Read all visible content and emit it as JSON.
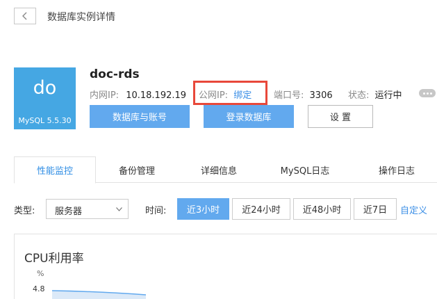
{
  "header": {
    "back_icon": "chevron-left-icon",
    "title": "数据库实例详情"
  },
  "instance": {
    "logo_abbr": "do",
    "logo_version": "MySQL 5.5.30",
    "name": "doc-rds",
    "intranet_ip_label": "内网IP:",
    "intranet_ip": "10.18.192.19",
    "public_ip_label": "公网IP:",
    "public_ip_action": "绑定",
    "port_label": "端口号:",
    "port": "3306",
    "status_label": "状态:",
    "status": "运行中",
    "more_icon": "more-dots-icon"
  },
  "actions": {
    "db_accounts": "数据库与账号",
    "login_db": "登录数据库",
    "settings": "设 置"
  },
  "tabs": [
    {
      "label": "性能监控",
      "active": true
    },
    {
      "label": "备份管理"
    },
    {
      "label": "详细信息"
    },
    {
      "label": "MySQL日志"
    },
    {
      "label": "操作日志"
    }
  ],
  "filters": {
    "type_label": "类型:",
    "type_value": "服务器",
    "time_label": "时间:",
    "ranges": [
      "近3小时",
      "近24小时",
      "近48小时",
      "近7日"
    ],
    "active_range": "近3小时",
    "custom": "自定义"
  },
  "chart": {
    "title": "CPU利用率",
    "unit": "%",
    "y_tick": "4.8"
  },
  "colors": {
    "accent": "#62a9ee",
    "link": "#3a8ee6",
    "logo_bg": "#45a7e3",
    "highlight": "#e8483a"
  }
}
